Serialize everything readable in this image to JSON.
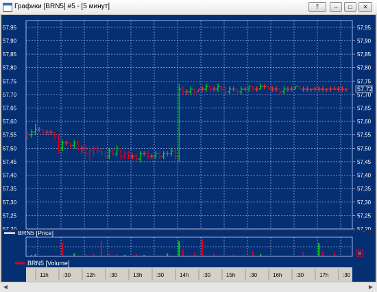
{
  "window": {
    "title": "Графики [BRN5] #5 - [5 минут]",
    "buttons": {
      "pin": "⤒",
      "minimize": "–",
      "maximize": "□",
      "close": "✕"
    }
  },
  "price_panel": {
    "legend": "BRN5 [Price]",
    "y_ticks": [
      "57,95",
      "57,90",
      "57,85",
      "57,80",
      "57,75",
      "57,70",
      "57,65",
      "57,60",
      "57,55",
      "57,50",
      "57,45",
      "57,40",
      "57,35",
      "57,30",
      "57,25",
      "57,20"
    ],
    "last_price_label": "57,72"
  },
  "volume_panel": {
    "legend": "BRN5 [Volume]"
  },
  "time_axis": {
    "labels": [
      "11h",
      ":30",
      "12h",
      ":30",
      "13h",
      ":30",
      "14h",
      ":30",
      "15h",
      ":30",
      "16h",
      ":30",
      "17h",
      ":30"
    ]
  },
  "colors": {
    "background": "#052f73",
    "up": "#00e400",
    "down": "#e0001e",
    "flat": "#ff3030",
    "grid": "#c8d0ff",
    "accent_legend": "#e0001e"
  },
  "chart_data": {
    "type": "bar",
    "title": "",
    "ylim": [
      57.2,
      57.975
    ],
    "x_range": [
      "10:45",
      "17:45"
    ],
    "series": [
      {
        "name": "BRN5 [Price]",
        "bars": [
          {
            "t": "10:47",
            "o": 57.55,
            "h": 57.56,
            "l": 57.53,
            "c": 57.55,
            "d": "down"
          },
          {
            "t": "10:52",
            "o": 57.55,
            "h": 57.57,
            "l": 57.54,
            "c": 57.56,
            "d": "up"
          },
          {
            "t": "10:57",
            "o": 57.56,
            "h": 57.59,
            "l": 57.55,
            "c": 57.57,
            "d": "up"
          },
          {
            "t": "11:02",
            "o": 57.57,
            "h": 57.58,
            "l": 57.56,
            "c": 57.57,
            "d": "flat"
          },
          {
            "t": "11:07",
            "o": 57.57,
            "h": 57.57,
            "l": 57.55,
            "c": 57.56,
            "d": "down"
          },
          {
            "t": "11:12",
            "o": 57.56,
            "h": 57.57,
            "l": 57.55,
            "c": 57.56,
            "d": "flat"
          },
          {
            "t": "11:17",
            "o": 57.56,
            "h": 57.57,
            "l": 57.55,
            "c": 57.56,
            "d": "flat"
          },
          {
            "t": "11:22",
            "o": 57.56,
            "h": 57.56,
            "l": 57.53,
            "c": 57.55,
            "d": "down"
          },
          {
            "t": "11:27",
            "o": 57.55,
            "h": 57.55,
            "l": 57.48,
            "c": 57.5,
            "d": "down"
          },
          {
            "t": "11:32",
            "o": 57.5,
            "h": 57.53,
            "l": 57.49,
            "c": 57.52,
            "d": "up"
          },
          {
            "t": "11:37",
            "o": 57.52,
            "h": 57.53,
            "l": 57.51,
            "c": 57.52,
            "d": "flat"
          },
          {
            "t": "11:42",
            "o": 57.52,
            "h": 57.52,
            "l": 57.5,
            "c": 57.51,
            "d": "down"
          },
          {
            "t": "11:47",
            "o": 57.51,
            "h": 57.53,
            "l": 57.5,
            "c": 57.52,
            "d": "up"
          },
          {
            "t": "11:52",
            "o": 57.52,
            "h": 57.53,
            "l": 57.49,
            "c": 57.5,
            "d": "down"
          },
          {
            "t": "11:57",
            "o": 57.5,
            "h": 57.51,
            "l": 57.48,
            "c": 57.5,
            "d": "flat"
          },
          {
            "t": "12:02",
            "o": 57.5,
            "h": 57.51,
            "l": 57.46,
            "c": 57.48,
            "d": "down"
          },
          {
            "t": "12:07",
            "o": 57.48,
            "h": 57.5,
            "l": 57.45,
            "c": 57.49,
            "d": "down"
          },
          {
            "t": "12:12",
            "o": 57.49,
            "h": 57.51,
            "l": 57.47,
            "c": 57.5,
            "d": "down"
          },
          {
            "t": "12:17",
            "o": 57.5,
            "h": 57.51,
            "l": 57.48,
            "c": 57.49,
            "d": "down"
          },
          {
            "t": "12:22",
            "o": 57.49,
            "h": 57.5,
            "l": 57.47,
            "c": 57.48,
            "d": "down"
          },
          {
            "t": "12:27",
            "o": 57.48,
            "h": 57.49,
            "l": 57.46,
            "c": 57.47,
            "d": "down"
          },
          {
            "t": "12:32",
            "o": 57.47,
            "h": 57.5,
            "l": 57.46,
            "c": 57.49,
            "d": "up"
          },
          {
            "t": "12:37",
            "o": 57.49,
            "h": 57.5,
            "l": 57.47,
            "c": 57.48,
            "d": "down"
          },
          {
            "t": "12:42",
            "o": 57.48,
            "h": 57.51,
            "l": 57.47,
            "c": 57.5,
            "d": "up"
          },
          {
            "t": "12:47",
            "o": 57.5,
            "h": 57.5,
            "l": 57.46,
            "c": 57.47,
            "d": "down"
          },
          {
            "t": "12:52",
            "o": 57.47,
            "h": 57.49,
            "l": 57.46,
            "c": 57.48,
            "d": "down"
          },
          {
            "t": "12:57",
            "o": 57.48,
            "h": 57.49,
            "l": 57.46,
            "c": 57.47,
            "d": "down"
          },
          {
            "t": "13:02",
            "o": 57.47,
            "h": 57.48,
            "l": 57.46,
            "c": 57.47,
            "d": "flat"
          },
          {
            "t": "13:07",
            "o": 57.47,
            "h": 57.48,
            "l": 57.45,
            "c": 57.46,
            "d": "down"
          },
          {
            "t": "13:12",
            "o": 57.46,
            "h": 57.49,
            "l": 57.45,
            "c": 57.48,
            "d": "up"
          },
          {
            "t": "13:17",
            "o": 57.48,
            "h": 57.49,
            "l": 57.47,
            "c": 57.48,
            "d": "flat"
          },
          {
            "t": "13:22",
            "o": 57.48,
            "h": 57.49,
            "l": 57.46,
            "c": 57.47,
            "d": "down"
          },
          {
            "t": "13:27",
            "o": 57.47,
            "h": 57.48,
            "l": 57.46,
            "c": 57.47,
            "d": "flat"
          },
          {
            "t": "13:32",
            "o": 57.47,
            "h": 57.49,
            "l": 57.46,
            "c": 57.48,
            "d": "up"
          },
          {
            "t": "13:37",
            "o": 57.48,
            "h": 57.49,
            "l": 57.46,
            "c": 57.47,
            "d": "down"
          },
          {
            "t": "13:42",
            "o": 57.47,
            "h": 57.49,
            "l": 57.46,
            "c": 57.48,
            "d": "up"
          },
          {
            "t": "13:47",
            "o": 57.48,
            "h": 57.49,
            "l": 57.47,
            "c": 57.48,
            "d": "flat"
          },
          {
            "t": "13:52",
            "o": 57.48,
            "h": 57.5,
            "l": 57.47,
            "c": 57.49,
            "d": "up"
          },
          {
            "t": "13:57",
            "o": 57.49,
            "h": 57.5,
            "l": 57.45,
            "c": 57.47,
            "d": "down"
          },
          {
            "t": "14:02",
            "o": 57.47,
            "h": 57.74,
            "l": 57.45,
            "c": 57.72,
            "d": "up"
          },
          {
            "t": "14:07",
            "o": 57.72,
            "h": 57.73,
            "l": 57.7,
            "c": 57.71,
            "d": "down"
          },
          {
            "t": "14:12",
            "o": 57.71,
            "h": 57.72,
            "l": 57.7,
            "c": 57.71,
            "d": "flat"
          },
          {
            "t": "14:17",
            "o": 57.71,
            "h": 57.73,
            "l": 57.7,
            "c": 57.72,
            "d": "up"
          },
          {
            "t": "14:22",
            "o": 57.72,
            "h": 57.72,
            "l": 57.7,
            "c": 57.71,
            "d": "down"
          },
          {
            "t": "14:27",
            "o": 57.71,
            "h": 57.72,
            "l": 57.71,
            "c": 57.72,
            "d": "flat"
          },
          {
            "t": "14:32",
            "o": 57.72,
            "h": 57.73,
            "l": 57.71,
            "c": 57.72,
            "d": "flat"
          },
          {
            "t": "14:37",
            "o": 57.72,
            "h": 57.74,
            "l": 57.71,
            "c": 57.73,
            "d": "up"
          },
          {
            "t": "14:42",
            "o": 57.73,
            "h": 57.73,
            "l": 57.71,
            "c": 57.72,
            "d": "down"
          },
          {
            "t": "14:47",
            "o": 57.72,
            "h": 57.73,
            "l": 57.71,
            "c": 57.72,
            "d": "flat"
          },
          {
            "t": "14:52",
            "o": 57.72,
            "h": 57.74,
            "l": 57.71,
            "c": 57.73,
            "d": "up"
          },
          {
            "t": "14:57",
            "o": 57.73,
            "h": 57.73,
            "l": 57.71,
            "c": 57.72,
            "d": "down"
          },
          {
            "t": "15:02",
            "o": 57.72,
            "h": 57.73,
            "l": 57.7,
            "c": 57.71,
            "d": "down"
          },
          {
            "t": "15:07",
            "o": 57.71,
            "h": 57.73,
            "l": 57.7,
            "c": 57.72,
            "d": "up"
          },
          {
            "t": "15:12",
            "o": 57.72,
            "h": 57.73,
            "l": 57.71,
            "c": 57.72,
            "d": "flat"
          },
          {
            "t": "15:17",
            "o": 57.72,
            "h": 57.72,
            "l": 57.7,
            "c": 57.71,
            "d": "down"
          },
          {
            "t": "15:22",
            "o": 57.71,
            "h": 57.73,
            "l": 57.7,
            "c": 57.72,
            "d": "up"
          },
          {
            "t": "15:27",
            "o": 57.72,
            "h": 57.73,
            "l": 57.71,
            "c": 57.72,
            "d": "flat"
          },
          {
            "t": "15:32",
            "o": 57.72,
            "h": 57.73,
            "l": 57.71,
            "c": 57.73,
            "d": "up"
          },
          {
            "t": "15:37",
            "o": 57.73,
            "h": 57.73,
            "l": 57.71,
            "c": 57.72,
            "d": "down"
          },
          {
            "t": "15:42",
            "o": 57.72,
            "h": 57.73,
            "l": 57.71,
            "c": 57.72,
            "d": "flat"
          },
          {
            "t": "15:47",
            "o": 57.72,
            "h": 57.74,
            "l": 57.72,
            "c": 57.73,
            "d": "up"
          },
          {
            "t": "15:52",
            "o": 57.73,
            "h": 57.74,
            "l": 57.72,
            "c": 57.73,
            "d": "flat"
          },
          {
            "t": "15:57",
            "o": 57.73,
            "h": 57.73,
            "l": 57.72,
            "c": 57.72,
            "d": "down"
          },
          {
            "t": "16:02",
            "o": 57.72,
            "h": 57.73,
            "l": 57.71,
            "c": 57.72,
            "d": "flat"
          },
          {
            "t": "16:07",
            "o": 57.72,
            "h": 57.73,
            "l": 57.71,
            "c": 57.72,
            "d": "flat"
          },
          {
            "t": "16:12",
            "o": 57.72,
            "h": 57.72,
            "l": 57.7,
            "c": 57.71,
            "d": "down"
          },
          {
            "t": "16:17",
            "o": 57.71,
            "h": 57.73,
            "l": 57.7,
            "c": 57.72,
            "d": "up"
          },
          {
            "t": "16:22",
            "o": 57.72,
            "h": 57.73,
            "l": 57.71,
            "c": 57.72,
            "d": "flat"
          },
          {
            "t": "16:27",
            "o": 57.72,
            "h": 57.73,
            "l": 57.71,
            "c": 57.72,
            "d": "flat"
          },
          {
            "t": "16:32",
            "o": 57.72,
            "h": 57.73,
            "l": 57.72,
            "c": 57.73,
            "d": "up"
          },
          {
            "t": "16:37",
            "o": 57.73,
            "h": 57.73,
            "l": 57.72,
            "c": 57.72,
            "d": "down"
          },
          {
            "t": "16:42",
            "o": 57.72,
            "h": 57.73,
            "l": 57.71,
            "c": 57.72,
            "d": "flat"
          },
          {
            "t": "16:47",
            "o": 57.72,
            "h": 57.73,
            "l": 57.71,
            "c": 57.72,
            "d": "flat"
          },
          {
            "t": "16:52",
            "o": 57.72,
            "h": 57.72,
            "l": 57.71,
            "c": 57.72,
            "d": "flat"
          },
          {
            "t": "16:57",
            "o": 57.72,
            "h": 57.73,
            "l": 57.71,
            "c": 57.72,
            "d": "flat"
          },
          {
            "t": "17:02",
            "o": 57.72,
            "h": 57.73,
            "l": 57.71,
            "c": 57.72,
            "d": "flat"
          },
          {
            "t": "17:07",
            "o": 57.72,
            "h": 57.73,
            "l": 57.71,
            "c": 57.72,
            "d": "flat"
          },
          {
            "t": "17:12",
            "o": 57.72,
            "h": 57.72,
            "l": 57.71,
            "c": 57.72,
            "d": "flat"
          },
          {
            "t": "17:17",
            "o": 57.72,
            "h": 57.73,
            "l": 57.71,
            "c": 57.72,
            "d": "flat"
          },
          {
            "t": "17:22",
            "o": 57.72,
            "h": 57.73,
            "l": 57.72,
            "c": 57.72,
            "d": "flat"
          },
          {
            "t": "17:27",
            "o": 57.72,
            "h": 57.73,
            "l": 57.71,
            "c": 57.72,
            "d": "flat"
          },
          {
            "t": "17:32",
            "o": 57.72,
            "h": 57.73,
            "l": 57.71,
            "c": 57.72,
            "d": "flat"
          },
          {
            "t": "17:37",
            "o": 57.72,
            "h": 57.72,
            "l": 57.71,
            "c": 57.72,
            "d": "flat"
          }
        ]
      },
      {
        "name": "BRN5 [Volume]",
        "volumes": [
          {
            "t": "10:52",
            "v": 1,
            "d": "up"
          },
          {
            "t": "10:57",
            "v": 2,
            "d": "up"
          },
          {
            "t": "11:17",
            "v": 1,
            "d": "down"
          },
          {
            "t": "11:32",
            "v": 18,
            "d": "down"
          },
          {
            "t": "11:37",
            "v": 1,
            "d": "down"
          },
          {
            "t": "11:47",
            "v": 3,
            "d": "up"
          },
          {
            "t": "12:02",
            "v": 2,
            "d": "down"
          },
          {
            "t": "12:12",
            "v": 3,
            "d": "down"
          },
          {
            "t": "12:22",
            "v": 20,
            "d": "down"
          },
          {
            "t": "12:32",
            "v": 3,
            "d": "down"
          },
          {
            "t": "12:42",
            "v": 2,
            "d": "down"
          },
          {
            "t": "12:52",
            "v": 1,
            "d": "up"
          },
          {
            "t": "13:07",
            "v": 2,
            "d": "down"
          },
          {
            "t": "13:17",
            "v": 1,
            "d": "up"
          },
          {
            "t": "13:47",
            "v": 3,
            "d": "up"
          },
          {
            "t": "14:02",
            "v": 20,
            "d": "up"
          },
          {
            "t": "14:07",
            "v": 8,
            "d": "down"
          },
          {
            "t": "14:22",
            "v": 4,
            "d": "down"
          },
          {
            "t": "14:32",
            "v": 23,
            "d": "down"
          },
          {
            "t": "14:47",
            "v": 3,
            "d": "down"
          },
          {
            "t": "15:12",
            "v": 2,
            "d": "down"
          },
          {
            "t": "15:37",
            "v": 6,
            "d": "down"
          },
          {
            "t": "15:47",
            "v": 2,
            "d": "up"
          },
          {
            "t": "16:12",
            "v": 1,
            "d": "down"
          },
          {
            "t": "16:42",
            "v": 5,
            "d": "down"
          },
          {
            "t": "17:02",
            "v": 17,
            "d": "up"
          },
          {
            "t": "17:07",
            "v": 6,
            "d": "down"
          },
          {
            "t": "17:22",
            "v": 4,
            "d": "down"
          }
        ]
      }
    ]
  }
}
